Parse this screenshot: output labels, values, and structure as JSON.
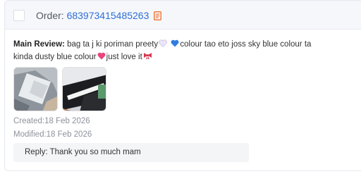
{
  "order": {
    "label": "Order:",
    "id": "683973415485263",
    "copy_icon": "copy-icon"
  },
  "review": {
    "label": "Main Review:",
    "text_part1": "bag ta j ki poriman preety",
    "text_part2": "colour tao eto joss sky blue colour ta kinda dusty blue colour",
    "text_part3": "just love it",
    "emojis": [
      "white-heart-icon",
      "blue-heart-icon",
      "pink-heart-icon",
      "ribbon-bow-icon"
    ]
  },
  "images": [
    {
      "name": "review-photo-1",
      "icon": "bag-photo"
    },
    {
      "name": "review-photo-2",
      "icon": "bag-photo"
    }
  ],
  "created": "Created:18 Feb 2026",
  "modified": "Modified:18 Feb 2026",
  "reply": "Reply: Thank you so much mam",
  "colors": {
    "accent": "#2f6fd6",
    "copy_icon": "#f07b3f",
    "header_bg": "#f5f7fb",
    "reply_bg": "#f4f5f7",
    "meta_text": "#8d929b"
  }
}
